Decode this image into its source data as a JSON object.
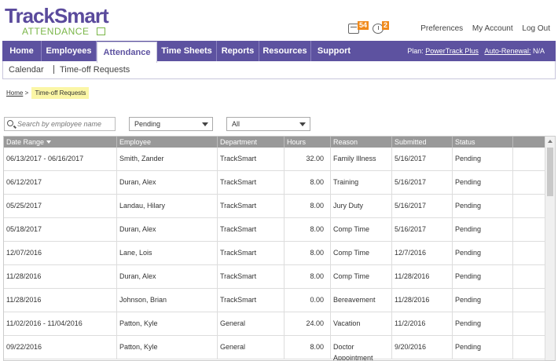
{
  "brand": {
    "name_main": "TrackSmart",
    "name_sub": "ATTENDANCE"
  },
  "notifications": {
    "messages_count": "54",
    "alerts_count": "2"
  },
  "top_links": [
    "Preferences",
    "My Account",
    "Log Out"
  ],
  "nav": {
    "tabs": [
      "Home",
      "Employees",
      "Attendance",
      "Time Sheets",
      "Reports",
      "Resources",
      "Support"
    ],
    "active": "Attendance",
    "plan_label": "Plan:",
    "plan_value": "PowerTrack Plus",
    "renewal_label": "Auto-Renewal:",
    "renewal_value": "N/A"
  },
  "subnav": {
    "items": [
      "Calendar",
      "Time-off Requests"
    ]
  },
  "breadcrumb": {
    "home": "Home",
    "sep": ">",
    "current": "Time-off Requests"
  },
  "filters": {
    "search_placeholder": "Search by employee name",
    "status_value": "Pending",
    "department_value": "All"
  },
  "table": {
    "columns": [
      "Date Range",
      "Employee",
      "Department",
      "Hours",
      "Reason",
      "Submitted",
      "Status",
      ""
    ],
    "rows": [
      {
        "date_range": "06/13/2017 - 06/16/2017",
        "employee": "Smith, Zander",
        "department": "TrackSmart",
        "hours": "32.00",
        "reason": "Family Illness",
        "submitted": "5/16/2017",
        "status": "Pending"
      },
      {
        "date_range": "06/12/2017",
        "employee": "Duran, Alex",
        "department": "TrackSmart",
        "hours": "8.00",
        "reason": "Training",
        "submitted": "5/16/2017",
        "status": "Pending"
      },
      {
        "date_range": "05/25/2017",
        "employee": "Landau, Hilary",
        "department": "TrackSmart",
        "hours": "8.00",
        "reason": "Jury Duty",
        "submitted": "5/16/2017",
        "status": "Pending"
      },
      {
        "date_range": "05/18/2017",
        "employee": "Duran, Alex",
        "department": "TrackSmart",
        "hours": "8.00",
        "reason": "Comp Time",
        "submitted": "5/16/2017",
        "status": "Pending"
      },
      {
        "date_range": "12/07/2016",
        "employee": "Lane, Lois",
        "department": "TrackSmart",
        "hours": "8.00",
        "reason": "Comp Time",
        "submitted": "12/7/2016",
        "status": "Pending"
      },
      {
        "date_range": "11/28/2016",
        "employee": "Duran, Alex",
        "department": "TrackSmart",
        "hours": "8.00",
        "reason": "Comp Time",
        "submitted": "11/28/2016",
        "status": "Pending"
      },
      {
        "date_range": "11/28/2016",
        "employee": "Johnson, Brian",
        "department": "TrackSmart",
        "hours": "0.00",
        "reason": "Bereavement",
        "submitted": "11/28/2016",
        "status": "Pending"
      },
      {
        "date_range": "11/02/2016 - 11/04/2016",
        "employee": "Patton, Kyle",
        "department": "General",
        "hours": "24.00",
        "reason": "Vacation",
        "submitted": "11/2/2016",
        "status": "Pending"
      },
      {
        "date_range": "09/22/2016",
        "employee": "Patton, Kyle",
        "department": "General",
        "hours": "8.00",
        "reason": "Doctor Appointment",
        "submitted": "9/20/2016",
        "status": "Pending"
      }
    ]
  },
  "colors": {
    "brand_purple": "#5d52a0",
    "brand_green": "#7ab648",
    "badge_orange": "#f08a1c",
    "highlight": "#fbf6a6"
  }
}
